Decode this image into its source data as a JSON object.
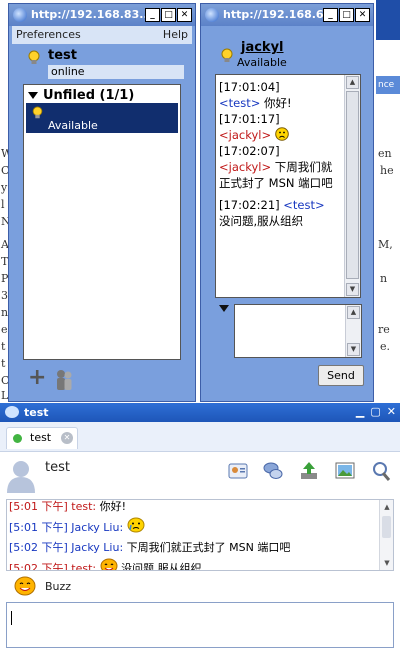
{
  "browser_bg": {
    "side_letters": [
      "W",
      "C",
      "y",
      "l",
      "N",
      "A",
      "T",
      "P",
      "3",
      "n",
      "e",
      "t",
      "t",
      "C",
      "L"
    ],
    "right_fragments": [
      "en",
      "he",
      "M,",
      "n",
      "re",
      "e."
    ],
    "strip_text": "nce"
  },
  "roster": {
    "title": "http://192.168.83...",
    "menu": {
      "left": "Preferences",
      "right": "Help"
    },
    "me": {
      "name": "test",
      "status": "online"
    },
    "group": {
      "label": "Unfiled (1/1)"
    },
    "contacts": [
      {
        "status": "Available"
      }
    ]
  },
  "chat": {
    "title": "http://192.168.6...",
    "peer": {
      "name": "jackyl",
      "status": "Available"
    },
    "messages": [
      {
        "time": "[17:01:04]",
        "from": "<test>",
        "text": " 你好!"
      },
      {
        "time": "[17:01:17]",
        "from": "<jackyl>",
        "text": ""
      },
      {
        "time": "[17:02:07]",
        "from": "<jackyl>",
        "text": " 下周我们就正式封了 MSN 端口吧"
      },
      {
        "time": "[17:02:21]",
        "from": "<test>",
        "text": " 没问题,服从组织"
      }
    ],
    "send_label": "Send"
  },
  "conversation": {
    "title": "test",
    "tab_label": "test",
    "buddy_name": "test",
    "history": [
      {
        "stamp": "[5:01 下午]",
        "from": "test:",
        "text": " 你好!",
        "side": "peer"
      },
      {
        "stamp": "[5:01 下午]",
        "from": "Jacky Liu:",
        "text": "",
        "side": "me"
      },
      {
        "stamp": "[5:02 下午]",
        "from": "Jacky Liu:",
        "text": " 下周我们就正式封了 MSN 端口吧",
        "side": "me"
      },
      {
        "stamp": "[5:02 下午]",
        "from": "test:",
        "text": " 没问题,服从组织",
        "side": "peer"
      }
    ],
    "buzz_label": "Buzz",
    "toolbar_icons": [
      "buddy-card-icon",
      "chat-bubbles-icon",
      "send-file-icon",
      "photo-icon",
      "settings-tools-icon"
    ]
  },
  "colors": {
    "xp_window": "#7a9fdd",
    "selection": "#112e6e",
    "my_name": "#1838c0",
    "peer_name": "#c01818",
    "pidgin_title": "#1e56b8"
  }
}
